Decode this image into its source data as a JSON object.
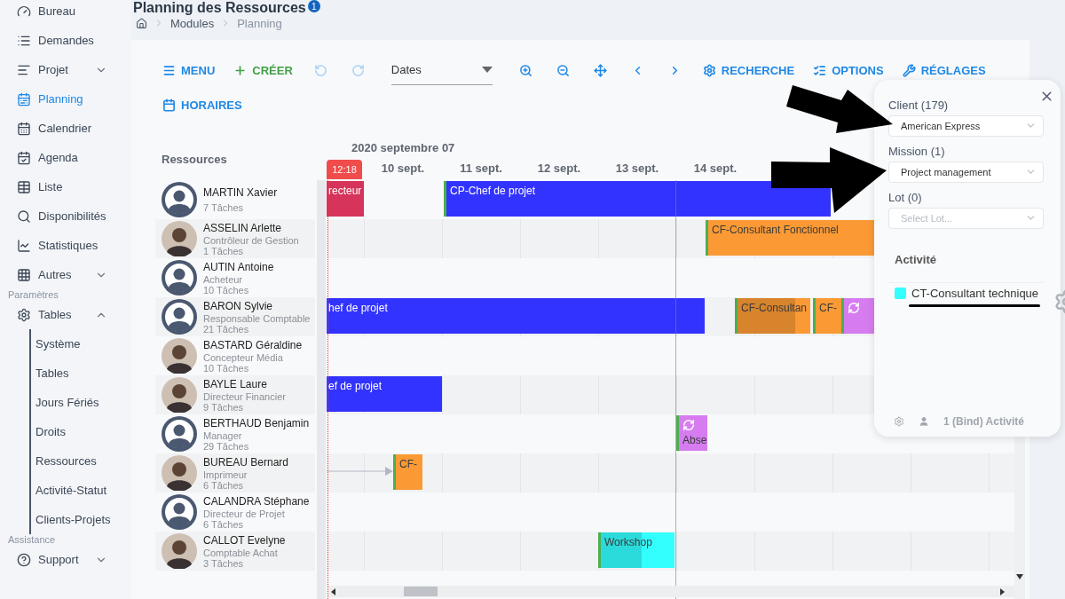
{
  "header": {
    "title": "Planning des Ressources",
    "badge": "1",
    "breadcrumb": [
      "Modules",
      "Planning"
    ]
  },
  "sidebar": [
    {
      "kind": "item",
      "label": "Bureau",
      "selected": false
    },
    {
      "kind": "item",
      "label": "Demandes",
      "selected": false
    },
    {
      "kind": "item",
      "label": "Projet",
      "selected": false,
      "expanded": false
    },
    {
      "kind": "item",
      "label": "Planning",
      "selected": true
    },
    {
      "kind": "item",
      "label": "Calendrier",
      "selected": false
    },
    {
      "kind": "item",
      "label": "Agenda",
      "selected": false
    },
    {
      "kind": "item",
      "label": "Liste",
      "selected": false
    },
    {
      "kind": "item",
      "label": "Disponibilités",
      "selected": false
    },
    {
      "kind": "item",
      "label": "Statistiques",
      "selected": false
    },
    {
      "kind": "item",
      "label": "Autres",
      "selected": false,
      "expanded": false
    },
    {
      "kind": "heading",
      "label": "Paramètres"
    },
    {
      "kind": "item",
      "label": "Tables",
      "selected": false,
      "expanded": true,
      "children": [
        {
          "label": "Système",
          "selected": false
        },
        {
          "label": "Tables",
          "selected": false
        },
        {
          "label": "Jours Fériés",
          "selected": false
        },
        {
          "label": "Droits",
          "selected": false
        },
        {
          "label": "Ressources",
          "selected": false
        },
        {
          "label": "Activité-Statut",
          "selected": false
        },
        {
          "label": "Clients-Projets",
          "selected": false
        }
      ]
    },
    {
      "kind": "heading",
      "label": "Assistance"
    },
    {
      "kind": "item",
      "label": "Support",
      "selected": false,
      "expanded": false
    }
  ],
  "toolbar": [
    [
      {
        "kind": "button",
        "label": "MENU",
        "color": "#1e88e5"
      },
      {
        "kind": "button",
        "label": "CRÉER",
        "color": "#43a047"
      },
      {
        "kind": "icon",
        "disabled": true
      },
      {
        "kind": "icon",
        "disabled": true
      },
      {
        "kind": "select",
        "value": "Dates"
      },
      {
        "kind": "icon",
        "disabled": false
      },
      {
        "kind": "icon",
        "disabled": false
      },
      {
        "kind": "icon",
        "disabled": false
      },
      {
        "kind": "icon",
        "disabled": false
      },
      {
        "kind": "icon",
        "disabled": false
      },
      {
        "kind": "button",
        "label": "RECHERCHE",
        "color": "#1e88e5"
      },
      {
        "kind": "button",
        "label": "OPTIONS",
        "color": "#1e88e5"
      },
      {
        "kind": "button",
        "label": "RÉGLAGES",
        "color": "#1e88e5"
      }
    ],
    [
      {
        "kind": "button",
        "label": "HORAIRES",
        "color": "#1e88e5"
      }
    ]
  ],
  "gantt": {
    "resources_heading": "Ressources",
    "date_heading": "2020 septembre 07",
    "now_label": "12:18",
    "days": [
      "10 sept.",
      "11 sept.",
      "12 sept.",
      "13 sept.",
      "14 sept."
    ],
    "rows": [
      {
        "name": "MARTIN Xavier",
        "tasks": "7 Tâches",
        "photo": false,
        "bars": [
          {
            "kind": "task",
            "label": "recteur",
            "color": "#d6345a"
          },
          {
            "kind": "task",
            "label": "CP-Chef de projet",
            "color": "#3333ff"
          }
        ]
      },
      {
        "name": "ASSELIN Arlette",
        "role": "Contrôleur de Gestion",
        "tasks": "1 Tâches",
        "photo": true,
        "bars": [
          {
            "kind": "task",
            "label": "CF-Consultant Fonctionnel",
            "color": "#fb9a35"
          }
        ]
      },
      {
        "name": "AUTIN Antoine",
        "role": "Acheteur",
        "tasks": "10 Tâches",
        "photo": false,
        "bars": []
      },
      {
        "name": "BARON Sylvie",
        "role": "Responsable Comptable",
        "tasks": "21 Tâches",
        "photo": false,
        "bars": [
          {
            "kind": "task",
            "label": "hef de projet",
            "color": "#3333ff"
          },
          {
            "kind": "task",
            "label": "CF-Consultan",
            "color": "#fb9a35",
            "level": 0.79
          },
          {
            "kind": "task",
            "label": "CF-",
            "color": "#fb9a35"
          },
          {
            "kind": "absence",
            "color": "#d67cf0"
          }
        ]
      },
      {
        "name": "BASTARD Géraldine",
        "role": "Concepteur Média",
        "tasks": "10 Tâches",
        "photo": true,
        "bars": []
      },
      {
        "name": "BAYLE Laure",
        "role": "Directeur Financier",
        "tasks": "9 Tâches",
        "photo": true,
        "bars": [
          {
            "kind": "task",
            "label": "ef de projet",
            "color": "#3333ff"
          }
        ]
      },
      {
        "name": "BERTHAUD Benjamin",
        "role": "Manager",
        "tasks": "29 Tâches",
        "photo": false,
        "bars": [
          {
            "kind": "absence",
            "label": "Abse",
            "color": "#d67cf0"
          }
        ]
      },
      {
        "name": "BUREAU Bernard",
        "role": "Imprimeur",
        "tasks": "6 Tâches",
        "photo": true,
        "bars": [
          {
            "kind": "link"
          },
          {
            "kind": "task",
            "label": "CF-",
            "color": "#fb9a35"
          }
        ]
      },
      {
        "name": "CALANDRA Stéphane",
        "role": "Directeur de Projet",
        "tasks": "6 Tâches",
        "photo": false,
        "bars": []
      },
      {
        "name": "CALLOT Evelyne",
        "role": "Comptable Achat",
        "tasks": "3 Tâches",
        "photo": true,
        "bars": [
          {
            "kind": "task",
            "label": "Workshop",
            "color": "#33ffff",
            "level": 0.56
          }
        ]
      }
    ]
  },
  "filter_panel": {
    "fields": [
      {
        "label": "Client (179)",
        "value": "American Express"
      },
      {
        "label": "Mission (1)",
        "value": "Project management"
      },
      {
        "label": "Lot (0)",
        "placeholder": "Select Lot..."
      }
    ],
    "activity_heading": "Activité",
    "activities": [
      {
        "label": "CT-Consultant technique",
        "color": "#33ffff"
      }
    ],
    "footer": "1 (Bind) Activité"
  }
}
